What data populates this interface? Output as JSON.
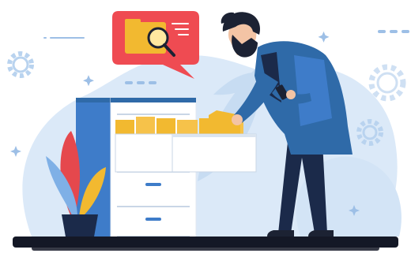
{
  "illustration": {
    "subject": "person-searching-file-cabinet",
    "icons": [
      "folder-search-icon",
      "gear-icon",
      "sparkle-icon"
    ],
    "colors": {
      "background_blob": "#dbe9f8",
      "background_blob_dark": "#c7dcf2",
      "ground": "#141826",
      "cabinet_side": "#3e7cc9",
      "cabinet_front": "#ffffff",
      "folder": "#f2b930",
      "speech_bubble": "#ef4b52",
      "coat": "#2f6aa8",
      "pants": "#1b2a4a",
      "hair": "#1c2233",
      "skin": "#f3c4a5",
      "plant_red": "#e5484d",
      "plant_yellow": "#f2b930",
      "plant_blue": "#7fb0e6",
      "pot": "#1b2a4a",
      "accent_gear": "#b9d3ef"
    }
  }
}
